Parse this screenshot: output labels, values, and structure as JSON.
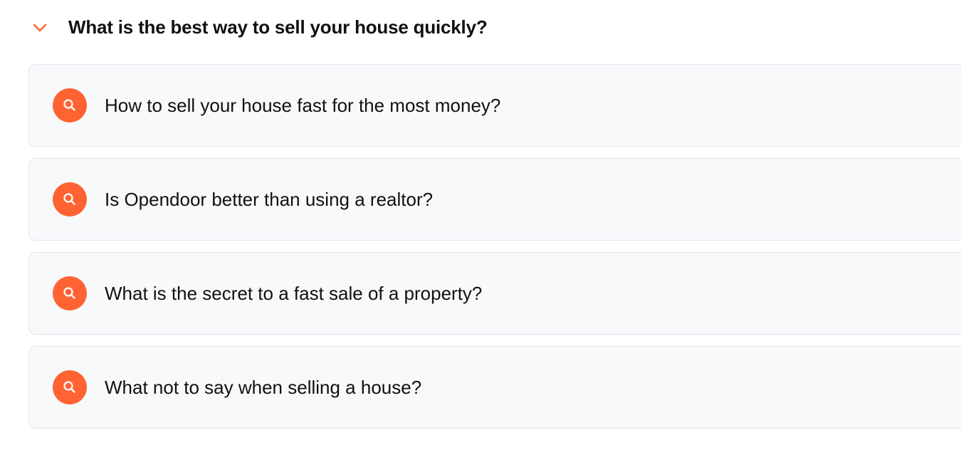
{
  "accent_color": "#ff6332",
  "section": {
    "title": "What is the best way to sell your house quickly?",
    "toggle_icon": "chevron-down-icon",
    "expanded": true
  },
  "questions": [
    {
      "label": "How to sell your house fast for the most money?",
      "icon": "search-icon"
    },
    {
      "label": "Is Opendoor better than using a realtor?",
      "icon": "search-icon"
    },
    {
      "label": "What is the secret to a fast sale of a property?",
      "icon": "search-icon"
    },
    {
      "label": "What not to say when selling a house?",
      "icon": "search-icon"
    }
  ]
}
